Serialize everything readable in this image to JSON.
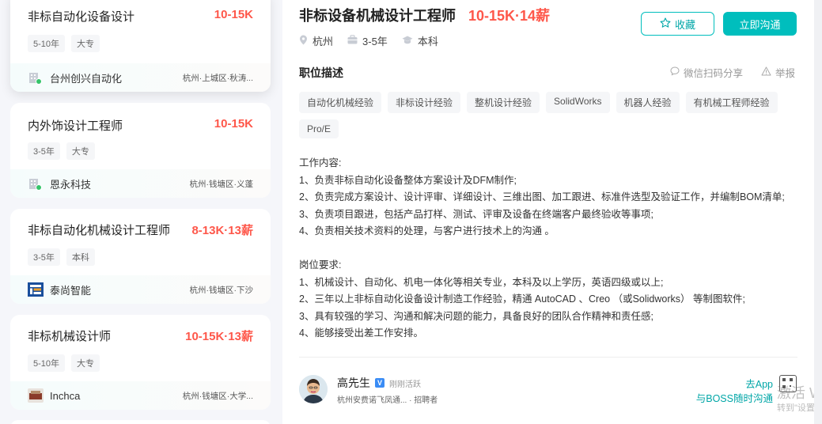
{
  "job_list": [
    {
      "title": "非标自动化设备设计",
      "salary": "10-15K",
      "tags": [
        "5-10年",
        "大专"
      ],
      "company": "台州创兴自动化",
      "location": "杭州·上城区·秋涛...",
      "logo_icon": "building-icon"
    },
    {
      "title": "内外饰设计工程师",
      "salary": "10-15K",
      "tags": [
        "3-5年",
        "大专"
      ],
      "company": "恩永科技",
      "location": "杭州·钱塘区·义蓬",
      "logo_icon": "building-icon"
    },
    {
      "title": "非标自动化机械设计工程师",
      "salary": "8-13K·13薪",
      "tags": [
        "3-5年",
        "本科"
      ],
      "company": "泰尚智能",
      "location": "杭州·钱塘区·下沙",
      "logo_icon": "taishang-logo"
    },
    {
      "title": "非标机械设计师",
      "salary": "10-15K·13薪",
      "tags": [
        "5-10年",
        "大专"
      ],
      "company": "Inchca",
      "location": "杭州·钱塘区·大学...",
      "logo_icon": "inchca-logo"
    }
  ],
  "detail": {
    "title": "非标设备机械设计工程师",
    "salary": "10-15K·14薪",
    "city": "杭州",
    "experience": "3-5年",
    "degree": "本科",
    "fav_label": "收藏",
    "chat_label": "立即沟通",
    "section_title": "职位描述",
    "share_label": "微信扫码分享",
    "report_label": "举报",
    "skills": [
      "自动化机械经验",
      "非标设计经验",
      "整机设计经验",
      "SolidWorks",
      "机器人经验",
      "有机械工程师经验",
      "Pro/E"
    ],
    "description": [
      "工作内容:",
      "1、负责非标自动化设备整体方案设计及DFM制作;",
      "2、负责完成方案设计、设计评审、详细设计、三维出图、加工跟进、标准件选型及验证工作，并编制BOM清单;",
      "3、负责项目跟进，包括产品打样、测试、评审及设备在终端客户最终验收等事项;",
      "4、负责相关技术资料的处理，与客户进行技术上的沟通 。",
      "",
      "岗位要求:",
      "1、机械设计、自动化、机电一体化等相关专业，本科及以上学历，英语四级或以上;",
      "2、三年以上非标自动化设备设计制造工作经验，精通 AutoCAD 、Creo （或Solidworks） 等制图软件;",
      "3、具有较强的学习、沟通和解决问题的能力，具备良好的团队合作精神和责任感;",
      "4、能够接受出差工作安排。"
    ],
    "recruiter": {
      "name": "高先生",
      "verified_mark": "V",
      "status": "刚刚活跃",
      "info": "杭州安费诺飞凤通... · 招聘者"
    },
    "app_link": "去App",
    "boss_link": "与BOSS随时沟通",
    "watermark": "激活 W",
    "watermark_sub": "转到\"设置\""
  },
  "colors": {
    "accent": "#00bebd",
    "salary": "#fe574a"
  }
}
